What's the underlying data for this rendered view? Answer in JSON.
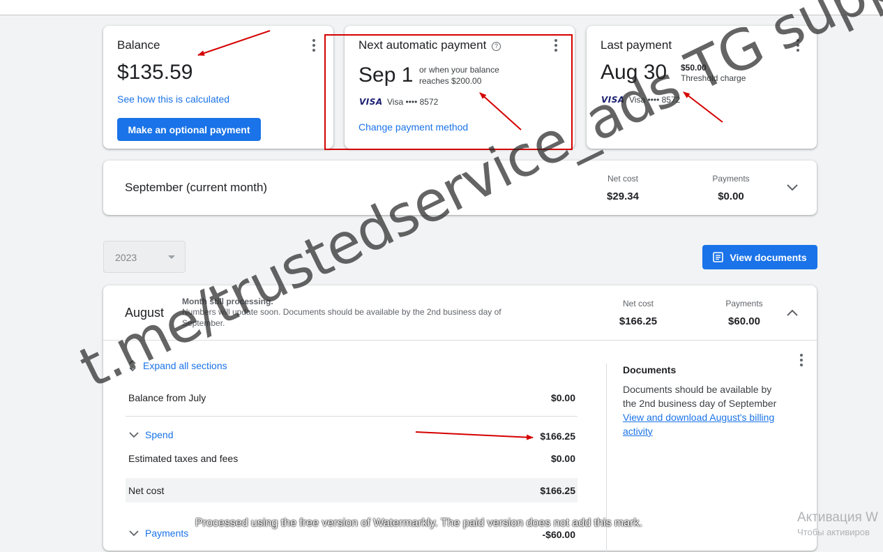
{
  "balance_card": {
    "title": "Balance",
    "amount": "$135.59",
    "calc_link": "See how this is calculated",
    "pay_button": "Make an optional payment"
  },
  "next_payment_card": {
    "title": "Next automatic payment",
    "date": "Sep 1",
    "condition_line1": "or when your balance",
    "condition_line2": "reaches $200.00",
    "card_brand": "VISA",
    "card_text": "Visa •••• 8572",
    "change_link": "Change payment method"
  },
  "last_payment_card": {
    "title": "Last payment",
    "date": "Aug 30",
    "amount": "$50.00",
    "reason": "Threshold charge",
    "card_brand": "VISA",
    "card_text": "Visa •••• 8572"
  },
  "current_month": {
    "title": "September (current month)",
    "net_cost_label": "Net cost",
    "net_cost_value": "$29.34",
    "payments_label": "Payments",
    "payments_value": "$0.00"
  },
  "year_select": {
    "value": "2023"
  },
  "view_documents_button": "View documents",
  "august": {
    "title": "August",
    "status_title": "Month still processing.",
    "status_line1": "Numbers will update soon. Documents should be available by the 2nd business day of",
    "status_line2": "September.",
    "net_cost_label": "Net cost",
    "net_cost_value": "$166.25",
    "payments_label": "Payments",
    "payments_value": "$60.00",
    "expand_all": "Expand all sections",
    "rows": [
      {
        "label": "Balance from July",
        "value": "$0.00"
      },
      {
        "label": "Spend",
        "value": "$166.25"
      },
      {
        "label": "Estimated taxes and fees",
        "value": "$0.00"
      },
      {
        "label": "Net cost",
        "value": "$166.25"
      },
      {
        "label": "Payments",
        "value": "-$60.00"
      }
    ],
    "documents": {
      "title": "Documents",
      "line1": "Documents should be available by",
      "line2": "the 2nd business day of September",
      "link_line1": "View and download August's billing",
      "link_line2": "activity"
    }
  },
  "overlays": {
    "watermark_text": "t.me/trustedservice_ads TG support",
    "watermarkly_notice": "Processed using the free version of Watermarkly. The paid version does not add this mark.",
    "activation_line1": "Активация W",
    "activation_line2": "Чтобы активиров"
  },
  "colors": {
    "accent": "#1a73e8",
    "highlight": "#d50000",
    "background": "#f1f3f4"
  }
}
